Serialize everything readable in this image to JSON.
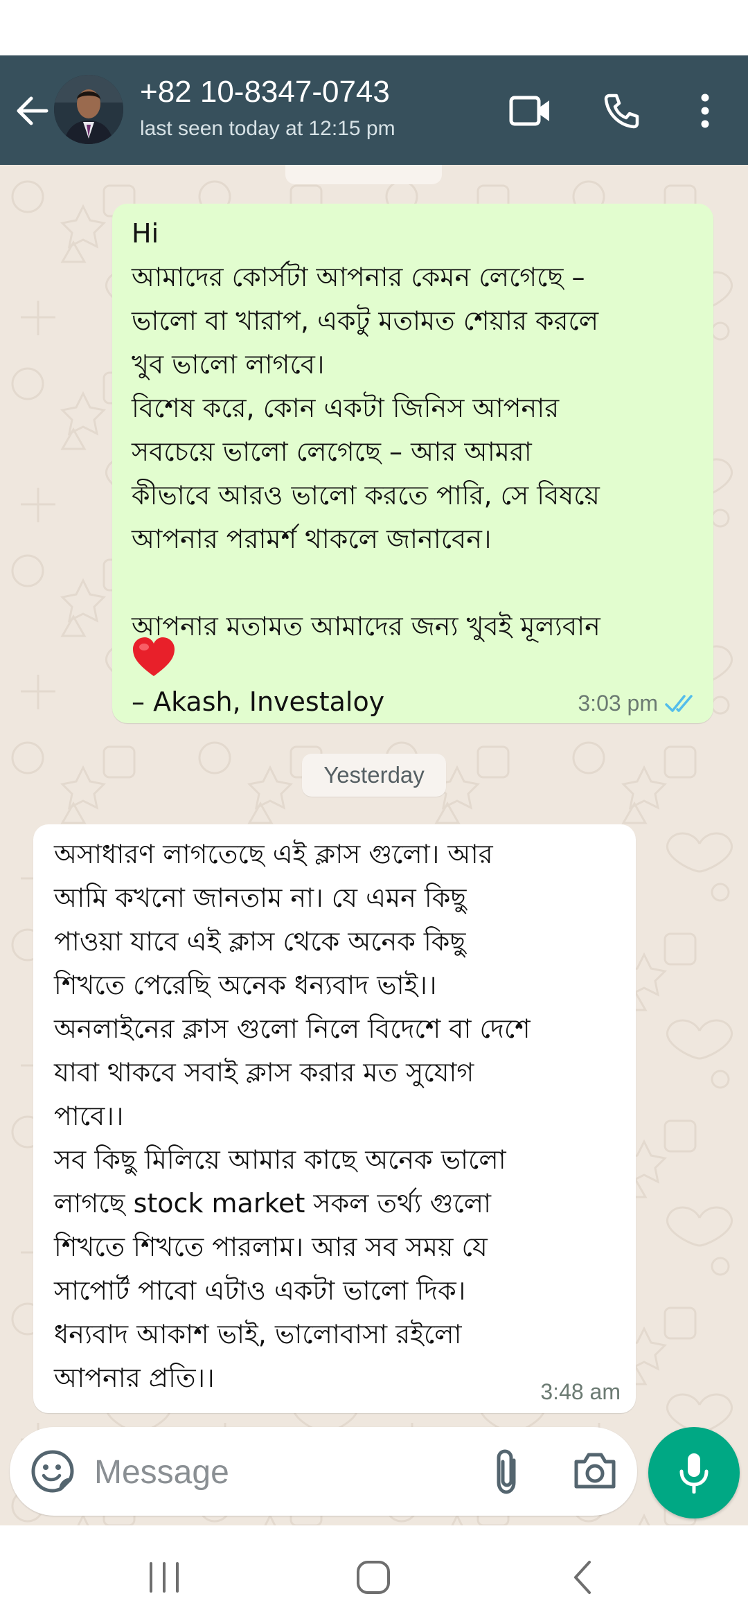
{
  "header": {
    "contact_name": "+82 10-8347-0743",
    "last_seen": "last seen today at 12:15 pm"
  },
  "messages": {
    "outgoing": {
      "text": "Hi\nআমাদের কোর্সটা আপনার কেমন লেগেছে –\nভালো বা খারাপ, একটু মতামত শেয়ার করলে\nখুব ভালো লাগবে।\nবিশেষ করে, কোন একটা জিনিস আপনার\nসবচেয়ে ভালো লেগেছে – আর আমরা\nকীভাবে আরও ভালো করতে পারি, সে বিষয়ে\nআপনার পরামর্শ থাকলে জানাবেন।\n\nআপনার মতামত আমাদের জন্য খুবই মূল্যবান",
      "signature": "– Akash, Investaloy",
      "time": "3:03 pm",
      "status": "read"
    },
    "date_divider": "Yesterday",
    "incoming": {
      "text": "অসাধারণ লাগতেছে এই ক্লাস গুলো। আর\nআমি কখনো জানতাম না। যে এমন কিছু\nপাওয়া যাবে এই ক্লাস থেকে অনেক কিছু\nশিখতে পেরেছি অনেক ধন্যবাদ ভাই।।\nঅনলাইনের ক্লাস গুলো নিলে বিদেশে বা দেশে\nযাবা থাকবে সবাই ক্লাস করার মত সুযোগ\nপাবে।।\nসব কিছু মিলিয়ে আমার কাছে অনেক ভালো\nলাগছে stock market সকল তর্থ্য গুলো\nশিখতে শিখতে পারলাম। আর সব সময় যে\nসাপোর্ট পাবো এটাও একটা ভালো দিক।\nধন্যবাদ আকাশ ভাই, ভালোবাসা রইলো\nআপনার প্রতি।।",
      "time": "3:48 am"
    }
  },
  "composer": {
    "placeholder": "Message"
  },
  "colors": {
    "header": "#37505c",
    "outgoing_bubble": "#e2fdcf",
    "chat_background": "#efe7de",
    "accent": "#00a884",
    "read_ticks": "#53bdeb"
  },
  "icons": {
    "back": "arrow-left-icon",
    "video": "video-camera-icon",
    "call": "phone-icon",
    "menu": "more-vertical-icon",
    "emoji": "emoji-sticker-icon",
    "attach": "paperclip-icon",
    "camera": "camera-icon",
    "mic": "microphone-icon"
  }
}
